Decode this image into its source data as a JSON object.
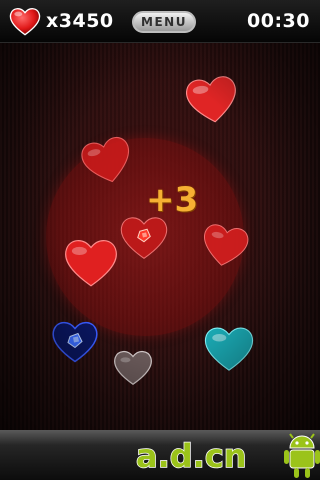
{
  "hud": {
    "score": "x3450",
    "menu_label": "MENU",
    "timer": "00:30"
  },
  "popup": {
    "bonus": "+3"
  },
  "hearts": [
    {
      "name": "red-heart",
      "color": "#e02525"
    },
    {
      "name": "red-heart",
      "color": "#d21c1c"
    },
    {
      "name": "red-heart",
      "color": "#e02020"
    },
    {
      "name": "red-heart",
      "color": "#d62020"
    },
    {
      "name": "red-heart-with-gem",
      "color": "#c81a1a"
    },
    {
      "name": "blue-heart-with-gem",
      "color": "#1a2ea8"
    },
    {
      "name": "gray-heart",
      "color": "#7a6a6a"
    },
    {
      "name": "cyan-heart",
      "color": "#1aa6b0"
    }
  ],
  "colors": {
    "topbar": "#0c0c0c",
    "playfield": "#2a1212",
    "score_text": "#ffffff",
    "bonus_text": "#f6b033",
    "watermark_green": "#9bc31a"
  },
  "watermark": {
    "text": "a.d.cn",
    "icon": "android-robot-icon"
  }
}
